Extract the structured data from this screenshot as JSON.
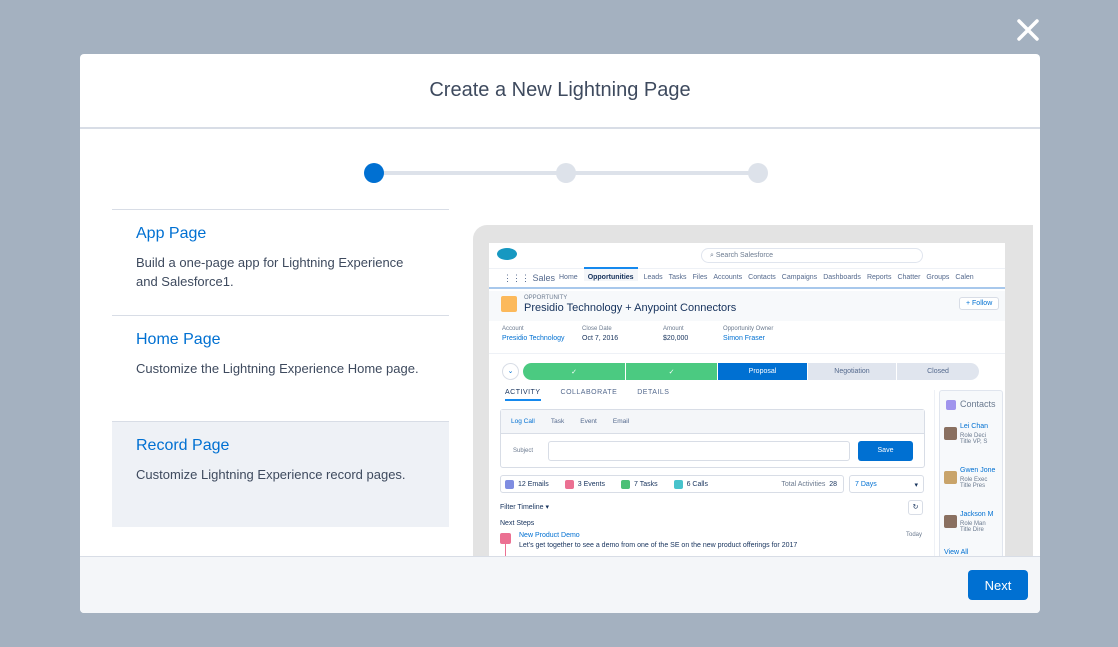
{
  "modal": {
    "title": "Create a New Lightning Page",
    "next_label": "Next"
  },
  "steps": {
    "count": 3,
    "current": 1
  },
  "page_types": [
    {
      "title": "App Page",
      "description": "Build a one-page app for Lightning Experience and Salesforce1.",
      "selected": false
    },
    {
      "title": "Home Page",
      "description": "Customize the Lightning Experience Home page.",
      "selected": false
    },
    {
      "title": "Record Page",
      "description": "Customize Lightning Experience record pages.",
      "selected": true
    }
  ],
  "preview": {
    "search_placeholder": "Search Salesforce",
    "app_name": "Sales",
    "nav": [
      "Home",
      "Opportunities",
      "Leads",
      "Tasks",
      "Files",
      "Accounts",
      "Contacts",
      "Campaigns",
      "Dashboards",
      "Reports",
      "Chatter",
      "Groups",
      "Calen"
    ],
    "record_type": "OPPORTUNITY",
    "record_title": "Presidio Technology + Anypoint Connectors",
    "follow_label": "+ Follow",
    "fields": [
      {
        "label": "Account",
        "value": "Presidio Technology"
      },
      {
        "label": "Close Date",
        "value": "Oct 7, 2016"
      },
      {
        "label": "Amount",
        "value": "$20,000"
      },
      {
        "label": "Opportunity Owner",
        "value": "Simon Fraser"
      }
    ],
    "path": [
      "✓",
      "✓",
      "Proposal",
      "Negotiation",
      "Closed"
    ],
    "tabs": [
      "ACTIVITY",
      "COLLABORATE",
      "DETAILS"
    ],
    "publisher_tabs": [
      "Log Call",
      "Task",
      "Event",
      "Email"
    ],
    "subject_label": "Subject",
    "save_label": "Save",
    "stats": [
      "12 Emails",
      "3 Events",
      "7 Tasks",
      "6 Calls"
    ],
    "total_label": "Total Activities",
    "total_value": "28",
    "range": "7 Days",
    "filter_label": "Filter Timeline",
    "next_steps": "Next Steps",
    "activity_title": "New Product Demo",
    "activity_date": "Today",
    "activity_text": "Let's get together to see a demo from one of the SE on the new product offerings for 2017",
    "contacts_title": "Contacts",
    "contacts": [
      {
        "name": "Lei Chan",
        "role_label": "Role",
        "role": "Deci",
        "title_label": "Title",
        "title": "VP, S"
      },
      {
        "name": "Gwen Jone",
        "role_label": "Role",
        "role": "Exec",
        "title_label": "Title",
        "title": "Pres"
      },
      {
        "name": "Jackson M",
        "role_label": "Role",
        "role": "Man",
        "title_label": "Title",
        "title": "Dire"
      }
    ],
    "view_all": "View All"
  },
  "colors": {
    "brand": "#0070d2",
    "path_done": "#4bca81",
    "backdrop": "#a4b1c0"
  }
}
